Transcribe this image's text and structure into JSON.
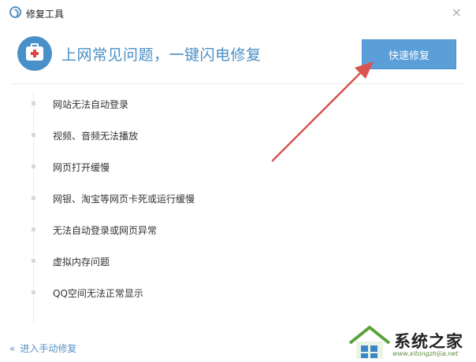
{
  "window": {
    "title": "修复工具",
    "close_glyph": "×"
  },
  "header": {
    "headline": "上网常见问题，一键闪电修复",
    "fix_button_label": "快速修复"
  },
  "issues": [
    "网站无法自动登录",
    "视频、音频无法播放",
    "网页打开缓慢",
    "网银、淘宝等网页卡死或运行缓慢",
    "无法自动登录或网页异常",
    "虚拟内存问题",
    "QQ空间无法正常显示"
  ],
  "footer": {
    "chevron": "«",
    "manual_link": "进入手动修复"
  },
  "watermark": {
    "text": "系统之家",
    "url": "www.xitongzhijia.net"
  },
  "colors": {
    "accent": "#5b9fd9",
    "headline": "#4a8fc6",
    "arrow": "#d9534f"
  }
}
